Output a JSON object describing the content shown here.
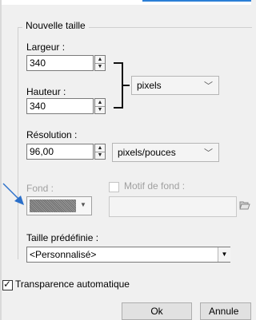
{
  "group_title": "Nouvelle taille",
  "width": {
    "label": "Largeur :",
    "value": "340"
  },
  "height": {
    "label": "Hauteur :",
    "value": "340"
  },
  "unit_select": {
    "value": "pixels"
  },
  "resolution": {
    "label": "Résolution :",
    "value": "96,00",
    "unit": "pixels/pouces"
  },
  "background": {
    "label": "Fond :",
    "pattern_label": "Motif de fond :"
  },
  "preset": {
    "label": "Taille prédéfinie :",
    "value": "<Personnalisé>"
  },
  "auto_transparency": {
    "label": "Transparence automatique",
    "checked": true
  },
  "buttons": {
    "ok": "Ok",
    "cancel": "Annule"
  },
  "colors": {
    "accent": "#2b7fd6",
    "pointer": "#2a6fc9"
  }
}
